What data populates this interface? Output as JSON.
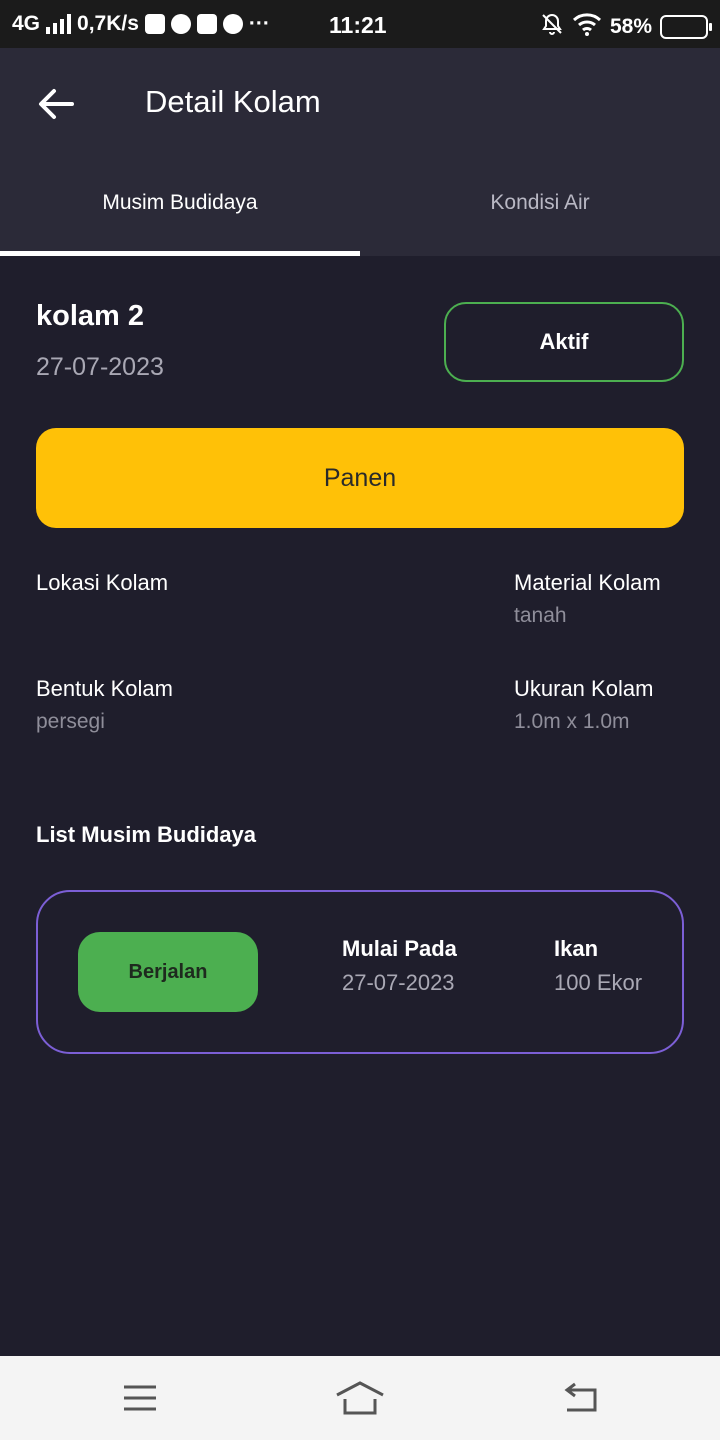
{
  "status_bar": {
    "network": "4G",
    "speed": "0,7K/s",
    "more": "···",
    "time": "11:21",
    "battery": "58%",
    "battery_level": 0.58
  },
  "appbar": {
    "title": "Detail Kolam",
    "back_icon": "arrow-left-icon"
  },
  "tabs": [
    {
      "label": "Musim Budidaya",
      "active": true
    },
    {
      "label": "Kondisi Air",
      "active": false
    }
  ],
  "pond": {
    "name": "kolam 2",
    "date": "27-07-2023",
    "status": "Aktif",
    "harvest_button": "Panen",
    "info": [
      {
        "label": "Lokasi Kolam",
        "value": ""
      },
      {
        "label": "Material Kolam",
        "value": "tanah"
      },
      {
        "label": "Bentuk Kolam",
        "value": "persegi"
      },
      {
        "label": "Ukuran Kolam",
        "value": "1.0m x 1.0m"
      }
    ]
  },
  "seasons": {
    "title": "List Musim Budidaya",
    "items": [
      {
        "status": "Berjalan",
        "start_label": "Mulai Pada",
        "start_value": "27-07-2023",
        "fish_label": "Ikan",
        "fish_value": "100 Ekor"
      }
    ]
  },
  "colors": {
    "background": "#1f1e2c",
    "appbar": "#2b2a38",
    "accent_yellow": "#ffc107",
    "accent_green": "#4caf50",
    "card_border": "#7c5fd6"
  },
  "nav": {
    "menu_icon": "menu-icon",
    "home_icon": "home-icon",
    "back_icon": "back-icon"
  }
}
